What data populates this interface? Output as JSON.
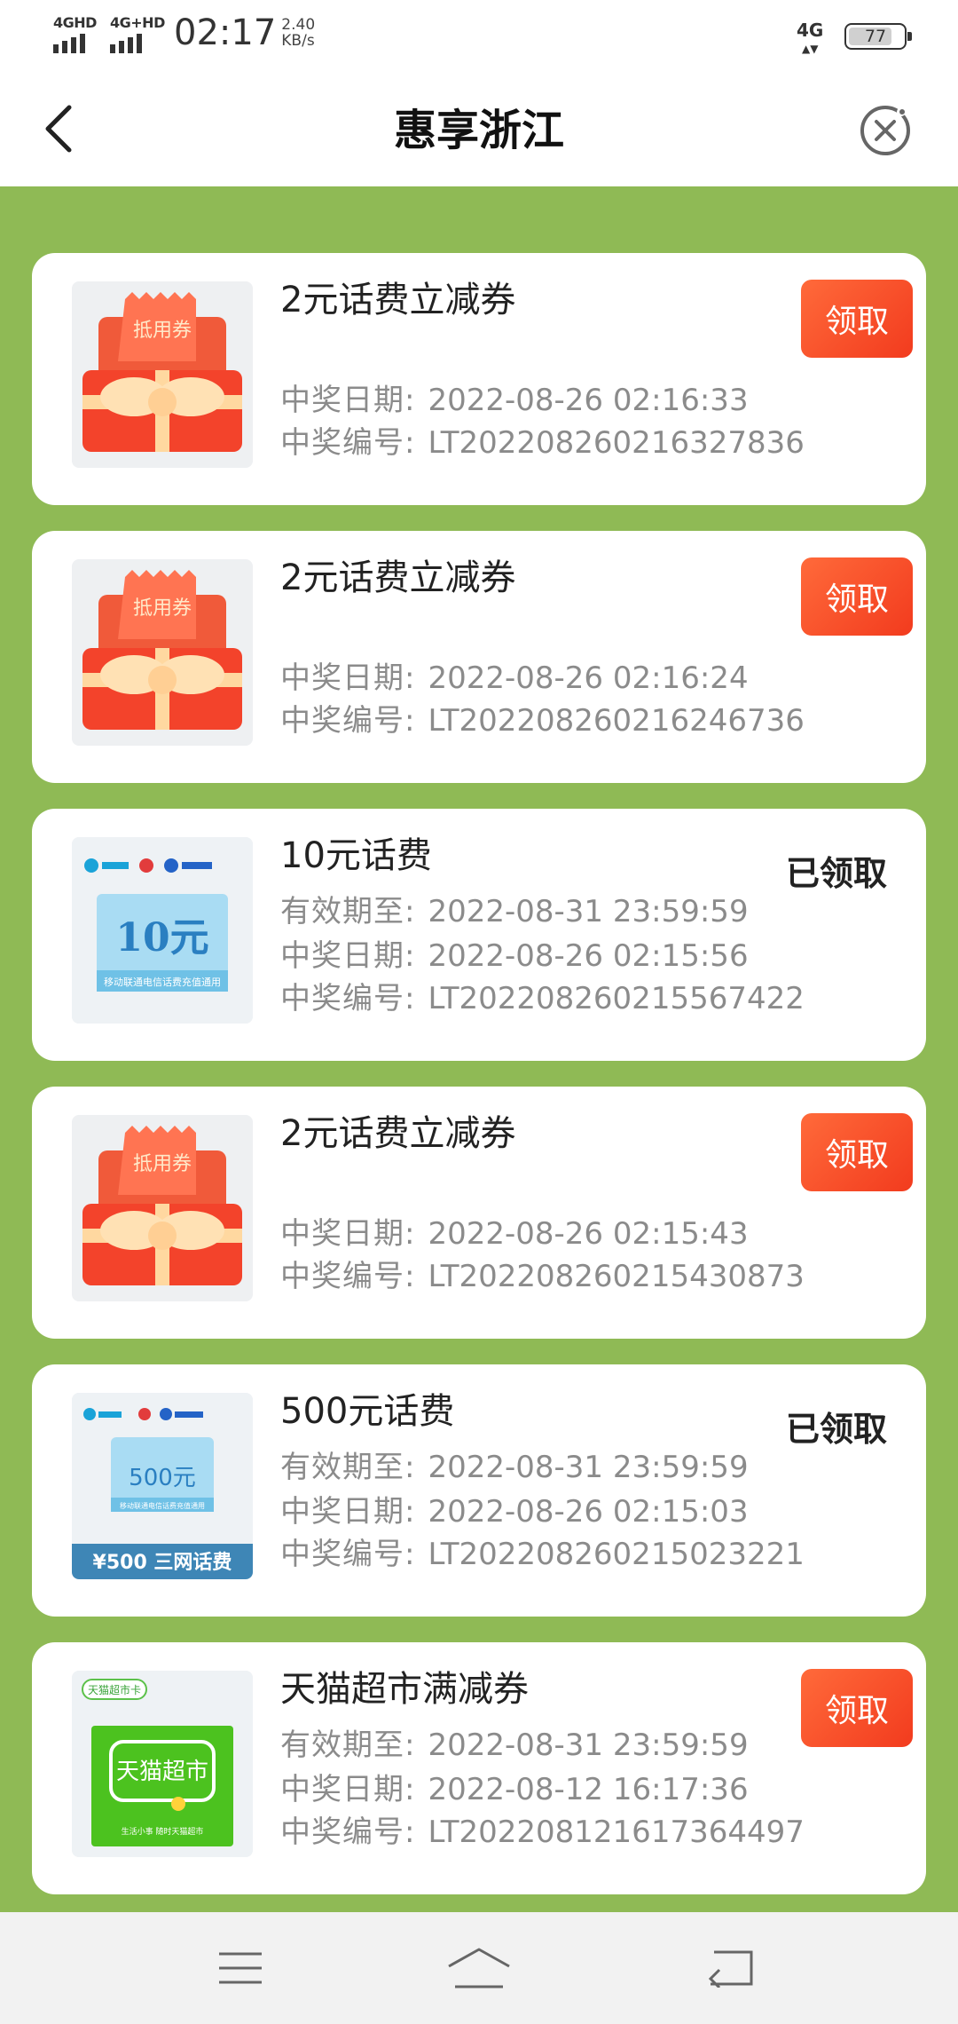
{
  "status_bar": {
    "sim1_label": "4GHD",
    "sim2_label": "4G+HD",
    "time": "02:17",
    "speed_value": "2.40",
    "speed_unit": "KB/s",
    "network_label": "4G",
    "battery_level": "77"
  },
  "header": {
    "title": "惠享浙江"
  },
  "labels": {
    "valid_until": "有效期至:",
    "win_date": "中奖日期:",
    "win_number": "中奖编号:"
  },
  "items": [
    {
      "title": "2元话费立减券",
      "valid_until": "",
      "win_date": "2022-08-26 02:16:33",
      "win_number": "LT202208260216327836",
      "action": "领取",
      "status": "",
      "thumb_text": "抵用券"
    },
    {
      "title": "2元话费立减券",
      "valid_until": "",
      "win_date": "2022-08-26 02:16:24",
      "win_number": "LT202208260216246736",
      "action": "领取",
      "status": "",
      "thumb_text": "抵用券"
    },
    {
      "title": "10元话费",
      "valid_until": "2022-08-31 23:59:59",
      "win_date": "2022-08-26 02:15:56",
      "win_number": "LT202208260215567422",
      "action": "",
      "status": "已领取",
      "thumb_text": "10元",
      "thumb_subtext": "移动联通电信话费充值通用"
    },
    {
      "title": "2元话费立减券",
      "valid_until": "",
      "win_date": "2022-08-26 02:15:43",
      "win_number": "LT202208260215430873",
      "action": "领取",
      "status": "",
      "thumb_text": "抵用券"
    },
    {
      "title": "500元话费",
      "valid_until": "2022-08-31 23:59:59",
      "win_date": "2022-08-26 02:15:03",
      "win_number": "LT202208260215023221",
      "action": "",
      "status": "已领取",
      "thumb_text": "500元",
      "thumb_subtext": "移动联通电信话费充值通用",
      "thumb_banner": "¥500 三网话费"
    },
    {
      "title": "天猫超市满减券",
      "valid_until": "2022-08-31 23:59:59",
      "win_date": "2022-08-12 16:17:36",
      "win_number": "LT202208121617364497",
      "action": "领取",
      "status": "",
      "thumb_tag": "天猫超市卡",
      "thumb_text": "天猫超市",
      "thumb_subtext": "生活小事 随时天猫超市"
    }
  ],
  "colors": {
    "background_green": "#8fba55",
    "claim_button": "#f2461f"
  }
}
